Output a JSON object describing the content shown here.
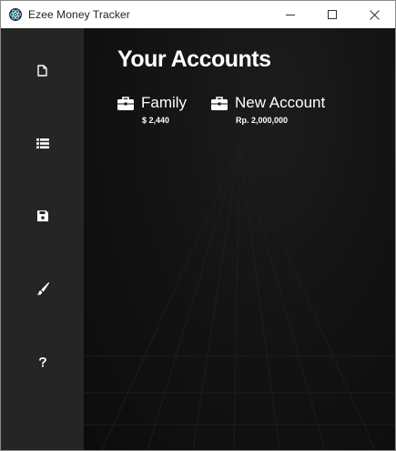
{
  "window": {
    "title": "Ezee Money Tracker",
    "controls": {
      "minimize": "minimize",
      "maximize": "maximize",
      "close": "close"
    }
  },
  "sidebar": {
    "items": [
      {
        "id": "new",
        "icon": "file-icon"
      },
      {
        "id": "list",
        "icon": "list-icon"
      },
      {
        "id": "save",
        "icon": "save-icon"
      },
      {
        "id": "theme",
        "icon": "paintbrush-icon"
      },
      {
        "id": "help",
        "icon": "question-icon"
      }
    ]
  },
  "main": {
    "title": "Your Accounts",
    "accounts": [
      {
        "name": "Family",
        "amount": "$ 2,440",
        "icon": "briefcase-icon"
      },
      {
        "name": "New Account",
        "amount": "Rp. 2,000,000",
        "icon": "briefcase-icon"
      }
    ]
  },
  "colors": {
    "sidebar_bg": "#252525",
    "main_bg": "#111111",
    "text": "#ffffff"
  }
}
